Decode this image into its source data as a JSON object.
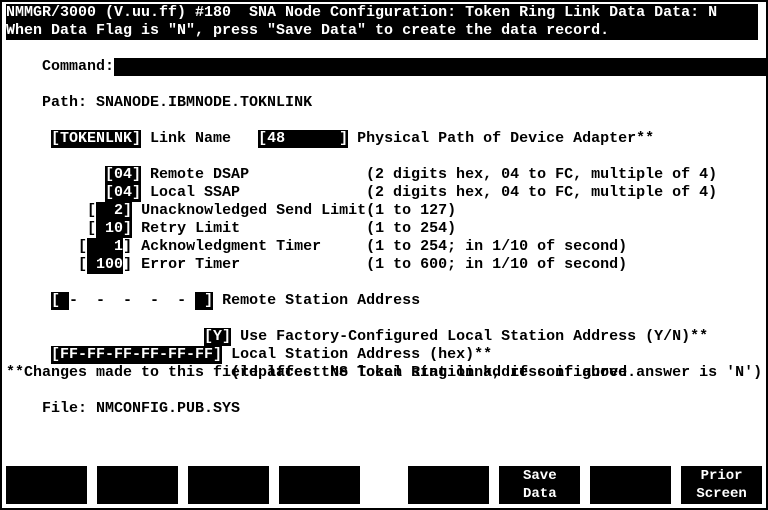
{
  "header": {
    "line1": "NMMGR/3000 (V.uu.ff) #180  SNA Node Configuration: Token Ring Link Data Data: N",
    "line2": "When Data Flag is \"N\", press \"Save Data\" to create the data record."
  },
  "command": {
    "label": "Command:"
  },
  "path": {
    "label": "Path: ",
    "value": "SNANODE.IBMNODE.TOKNLINK"
  },
  "fields": {
    "link_name": {
      "value": "[TOKENLNK]",
      "label": " Link Name   "
    },
    "phys_path": {
      "value": "[48      ]",
      "label": " Physical Path of Device Adapter**"
    },
    "remote_dsap": {
      "value": "[04]",
      "label": " Remote DSAP",
      "hint": "(2 digits hex, 04 to FC, multiple of 4)"
    },
    "local_ssap": {
      "value": "[04]",
      "label": " Local SSAP",
      "hint": "(2 digits hex, 04 to FC, multiple of 4)"
    },
    "unack_send": {
      "open": "[",
      "value": "  2]",
      "label": " Unacknowledged Send Limit",
      "hint": "(1 to 127)"
    },
    "retry_limit": {
      "open": "[",
      "value": " 10]",
      "label": " Retry Limit",
      "hint": "(1 to 254)"
    },
    "ack_timer": {
      "open": "[",
      "close": "]",
      "value": "   1",
      "label": " Acknowledgment Timer",
      "hint": "(1 to 254; in 1/10 of second)"
    },
    "err_timer": {
      "open": "[",
      "close": "]",
      "value": " 100",
      "label": " Error Timer",
      "hint": "(1 to 600; in 1/10 of second)"
    },
    "remote_addr": {
      "open": "[ ",
      "value": "-  -  -  -  - ",
      "close": " ]",
      "label": " Remote Station Address"
    },
    "use_factory": {
      "value": "[Y]",
      "label": " Use Factory-Configured Local Station Address (Y/N)**"
    },
    "local_addr": {
      "value": "[FF-FF-FF-FF-FF-FF]",
      "label": " Local Station Address (hex)**"
    },
    "local_addr_note": "(replaces the local station address if above answer is 'N')"
  },
  "footer": {
    "note": "**Changes made to this field affect NS Token Ring link, if configured.",
    "file_label": "File: ",
    "file_value": "NMCONFIG.PUB.SYS"
  },
  "fkeys": {
    "k1": "",
    "k2": "",
    "k3": "",
    "k4": "",
    "k5": "",
    "k6a": "Save",
    "k6b": "Data",
    "k7": "",
    "k8a": "Prior",
    "k8b": "Screen"
  }
}
